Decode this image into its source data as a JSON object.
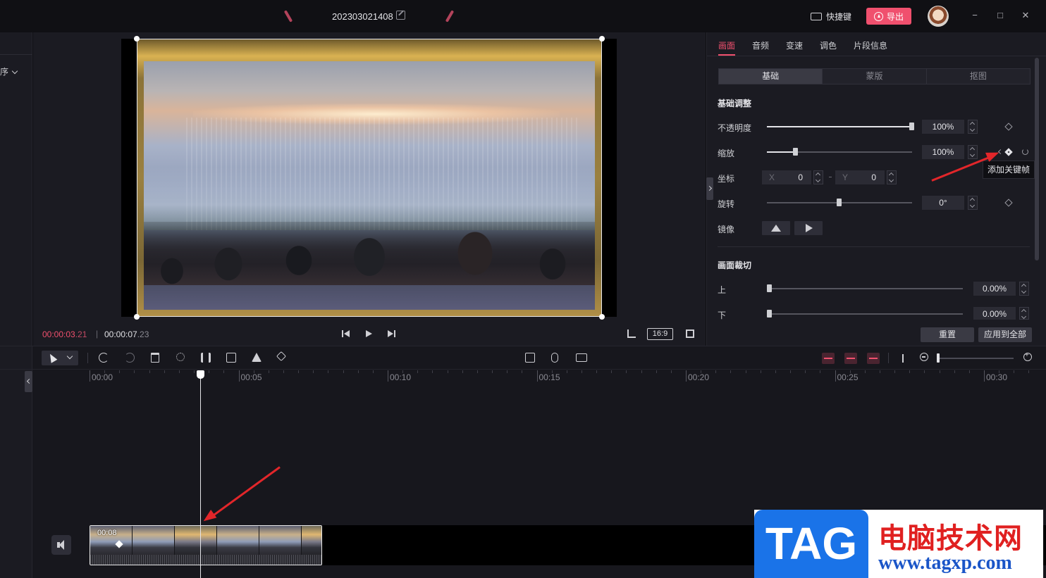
{
  "titlebar": {
    "project_name": "202303021408",
    "shortcut_label": "快捷键",
    "export_label": "导出",
    "minimize": "−",
    "maximize": "□",
    "close": "✕"
  },
  "left_panel": {
    "sort_label": "排序"
  },
  "preview": {
    "current_time": "00:00:03",
    "current_frame": ".21",
    "total_time": "00:00:07",
    "total_frame": ".23",
    "ratio_label": "16:9"
  },
  "properties": {
    "tabs": [
      "画面",
      "音频",
      "变速",
      "调色",
      "片段信息"
    ],
    "active_tab": "画面",
    "sub_tabs": [
      "基础",
      "蒙版",
      "抠图"
    ],
    "active_sub_tab": "基础",
    "basic_section_title": "基础调整",
    "opacity": {
      "label": "不透明度",
      "value": "100%",
      "level": 1.0
    },
    "scale": {
      "label": "缩放",
      "value": "100%",
      "level": 0.2
    },
    "position": {
      "label": "坐标",
      "x_label": "X",
      "x_value": "0",
      "y_label": "Y",
      "y_value": "0"
    },
    "rotation": {
      "label": "旋转",
      "value": "0°",
      "level": 0.5
    },
    "mirror_label": "镜像",
    "keyframe_tooltip": "添加关键帧",
    "crop_section_title": "画面裁切",
    "crop_top": {
      "label": "上",
      "value": "0.00%",
      "level": 0.0
    },
    "crop_bottom": {
      "label": "下",
      "value": "0.00%",
      "level": 0.0
    },
    "reset_label": "重置",
    "apply_all_label": "应用到全部"
  },
  "timeline": {
    "ruler_ticks": [
      "00:00",
      "00:05",
      "00:10",
      "00:15",
      "00:20",
      "00:25",
      "00:30"
    ],
    "clip_duration": "00:08"
  },
  "watermark": {
    "tag": "TAG",
    "site_name": "电脑技术网",
    "url": "www.tagxp.com"
  },
  "colors": {
    "accent": "#f0506e",
    "background": "#1b1b22",
    "annotation_arrow": "#e2262a"
  }
}
